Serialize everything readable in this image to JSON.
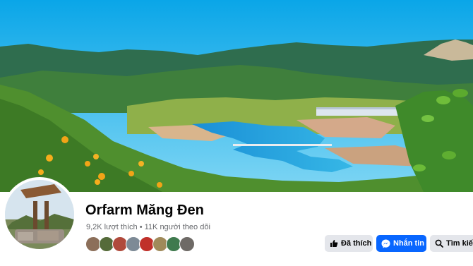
{
  "page": {
    "name": "Orfarm Măng Đen",
    "stats": "9,2K lượt thích • 11K người theo dõi"
  },
  "actions": {
    "like_label": "Đã thích",
    "message_label": "Nhắn tin",
    "search_label": "Tìm kiếm"
  },
  "followers": [
    {
      "icon": "follower-avatar",
      "color": "#8c6f5a"
    },
    {
      "icon": "follower-avatar",
      "color": "#556b3a"
    },
    {
      "icon": "follower-avatar",
      "color": "#b04a3c"
    },
    {
      "icon": "follower-avatar",
      "color": "#7d8a96"
    },
    {
      "icon": "follower-avatar",
      "color": "#c0302a"
    },
    {
      "icon": "follower-avatar",
      "color": "#a08a5a"
    },
    {
      "icon": "follower-avatar",
      "color": "#3f7a4e"
    },
    {
      "icon": "follower-avatar",
      "color": "#6e6a66"
    }
  ],
  "colors": {
    "accent": "#0866ff",
    "secondary_button": "#e4e6eb",
    "muted_text": "#65676b"
  }
}
